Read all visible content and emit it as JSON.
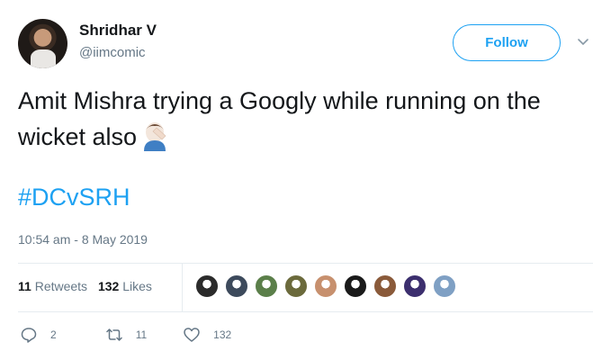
{
  "author": {
    "name": "Shridhar V",
    "handle": "@iimcomic"
  },
  "follow_label": "Follow",
  "tweet": {
    "text": "Amit Mishra trying a Googly while running on the wicket also",
    "emoji": "man-facepalming",
    "hashtag": "#DCvSRH"
  },
  "timestamp": "10:54 am - 8 May 2019",
  "stats": {
    "retweets_count": "11",
    "retweets_label": "Retweets",
    "likes_count": "132",
    "likes_label": "Likes"
  },
  "likers_colors": [
    "#2b2b2b",
    "#3d4a5c",
    "#5b7f4a",
    "#6b6a3c",
    "#c7906e",
    "#1a1a1a",
    "#8a5a3a",
    "#3c2f6e",
    "#7fa0c4"
  ],
  "actions": {
    "reply_count": "2",
    "retweet_count": "11",
    "like_count": "132"
  },
  "colors": {
    "accent": "#1da1f2",
    "muted": "#657786",
    "text": "#14171a"
  }
}
